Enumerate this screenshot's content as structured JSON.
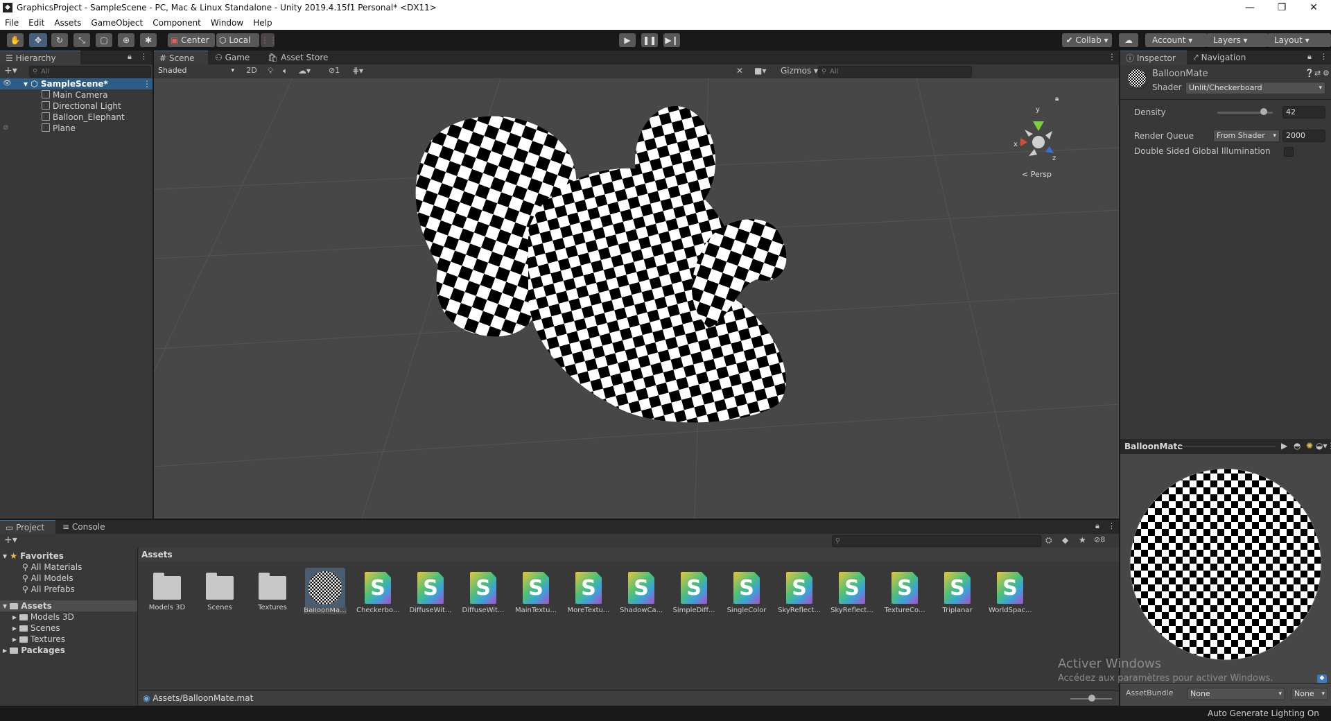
{
  "window": {
    "title": "GraphicsProject - SampleScene - PC, Mac & Linux Standalone - Unity 2019.4.15f1 Personal* <DX11>"
  },
  "menu": [
    "File",
    "Edit",
    "Assets",
    "GameObject",
    "Component",
    "Window",
    "Help"
  ],
  "toolbar": {
    "center": "Center",
    "local": "Local",
    "collab": "Collab",
    "account": "Account",
    "layers": "Layers",
    "layout": "Layout"
  },
  "hierarchy": {
    "tab": "Hierarchy",
    "search_placeholder": "All",
    "scene": "SampleScene*",
    "items": [
      "Main Camera",
      "Directional Light",
      "Balloon_Elephant",
      "Plane"
    ]
  },
  "scene": {
    "tabs": [
      "Scene",
      "Game",
      "Asset Store"
    ],
    "shading": "Shaded",
    "mode2d": "2D",
    "hidden_count": "1",
    "gizmos": "Gizmos",
    "search_placeholder": "All",
    "persp": "< Persp",
    "axis_y": "y",
    "axis_x": "x",
    "axis_z": "z"
  },
  "inspector": {
    "tabs": [
      "Inspector",
      "Navigation"
    ],
    "material": "BalloonMate",
    "shader_label": "Shader",
    "shader": "Unlit/Checkerboard",
    "density_label": "Density",
    "density": "42",
    "density_slider": 0.84,
    "render_queue_label": "Render Queue",
    "render_queue_mode": "From Shader",
    "render_queue": "2000",
    "double_sided_label": "Double Sided Global Illumination",
    "preview_title": "BalloonMate",
    "assetbundle_label": "AssetBundle",
    "assetbundle": "None",
    "assetbundle_variant": "None"
  },
  "project": {
    "tabs": [
      "Project",
      "Console"
    ],
    "hidden_count": "8",
    "favorites": "Favorites",
    "favorite_items": [
      "All Materials",
      "All Models",
      "All Prefabs"
    ],
    "assets_root": "Assets",
    "asset_folders": [
      "Models 3D",
      "Scenes",
      "Textures"
    ],
    "packages": "Packages",
    "breadcrumb": "Assets",
    "assets": [
      {
        "label": "Models 3D",
        "kind": "folder"
      },
      {
        "label": "Scenes",
        "kind": "folder"
      },
      {
        "label": "Textures",
        "kind": "folder"
      },
      {
        "label": "BalloonMa...",
        "kind": "material"
      },
      {
        "label": "Checkerbo...",
        "kind": "shader"
      },
      {
        "label": "DiffuseWit...",
        "kind": "shader"
      },
      {
        "label": "DiffuseWit...",
        "kind": "shader"
      },
      {
        "label": "MainTextu...",
        "kind": "shader"
      },
      {
        "label": "MoreTextu...",
        "kind": "shader"
      },
      {
        "label": "ShadowCa...",
        "kind": "shader"
      },
      {
        "label": "SimpleDiff...",
        "kind": "shader"
      },
      {
        "label": "SingleColor",
        "kind": "shader"
      },
      {
        "label": "SkyReflect...",
        "kind": "shader"
      },
      {
        "label": "SkyReflect...",
        "kind": "shader"
      },
      {
        "label": "TextureCo...",
        "kind": "shader"
      },
      {
        "label": "Triplanar",
        "kind": "shader"
      },
      {
        "label": "WorldSpac...",
        "kind": "shader"
      }
    ],
    "shader_glyph": "S",
    "selected_path": "Assets/BalloonMate.mat"
  },
  "watermark": {
    "title": "Activer Windows",
    "subtitle": "Accédez aux paramètres pour activer Windows."
  },
  "statusbar": {
    "text": "Auto Generate Lighting On"
  },
  "colors": {
    "selection": "#2c5d87",
    "accent": "#3a79bb",
    "background": "#474747"
  }
}
